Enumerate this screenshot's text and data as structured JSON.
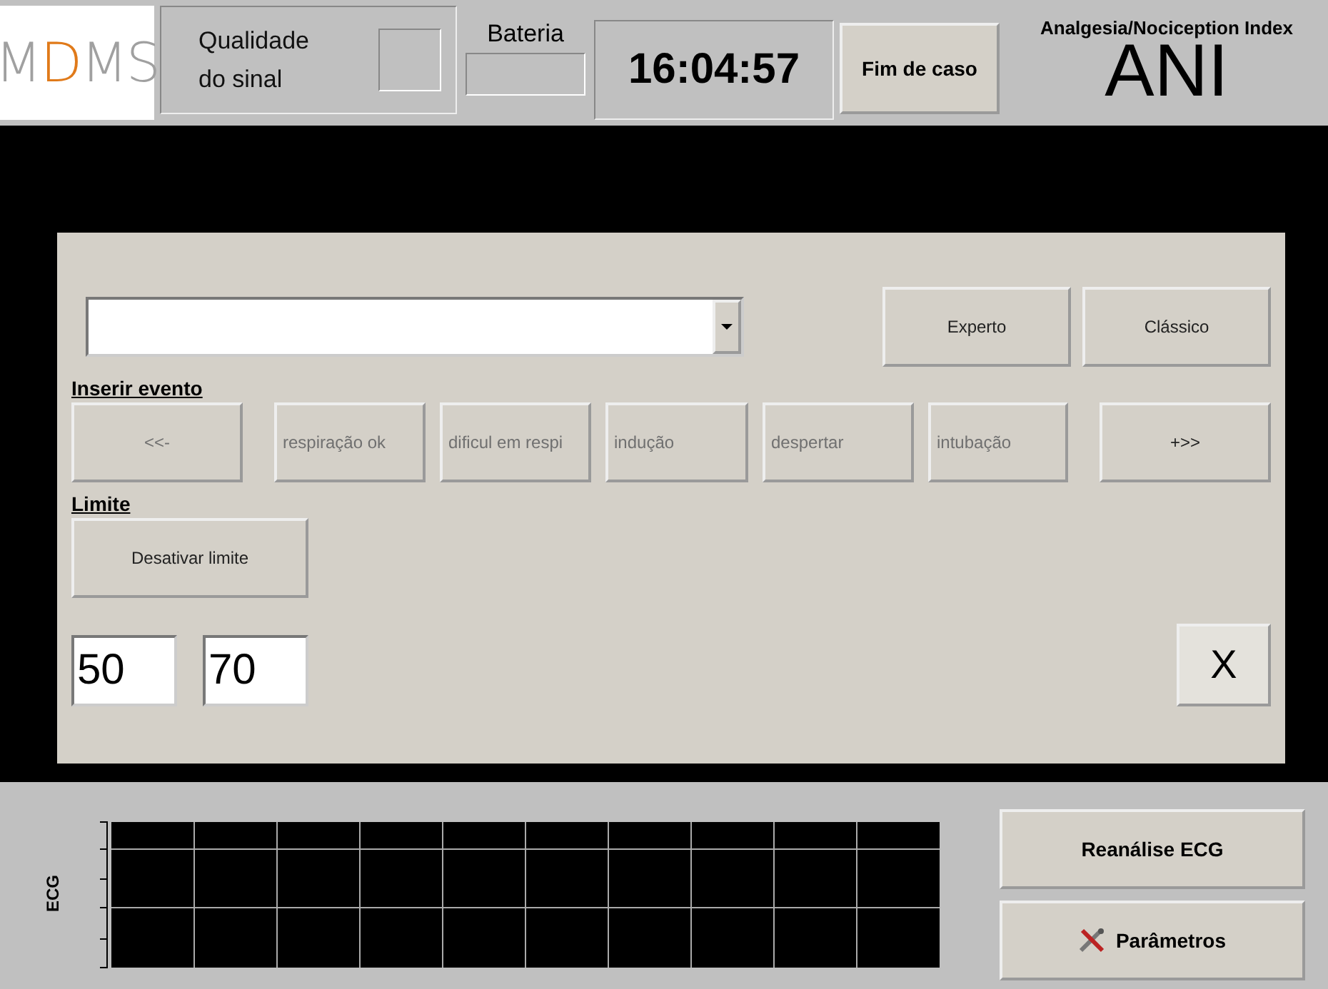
{
  "logo": [
    {
      "text": "M",
      "accent": false
    },
    {
      "text": "D",
      "accent": true
    },
    {
      "text": "M",
      "accent": false
    },
    {
      "text": "S",
      "accent": false
    }
  ],
  "signal_quality": {
    "label_lines": [
      "Qualidade",
      "do sinal"
    ]
  },
  "battery": {
    "label": "Bateria"
  },
  "clock": "16:04:57",
  "end_case_button": "Fim de caso",
  "index": {
    "subtitle": "Analgesia/Nociception Index",
    "name": "ANI"
  },
  "mode_buttons": [
    "Experto",
    "Clássico"
  ],
  "insert_event": {
    "heading": "Inserir evento",
    "buttons": [
      {
        "label": "<<-",
        "disabled": true
      },
      {
        "label": "respiração ok",
        "disabled": true
      },
      {
        "label": "dificul em respi",
        "disabled": true
      },
      {
        "label": "indução",
        "disabled": true
      },
      {
        "label": "despertar",
        "disabled": true
      },
      {
        "label": "intubação",
        "disabled": true
      },
      {
        "label": "+>>",
        "disabled": false
      }
    ]
  },
  "limit": {
    "heading": "Limite",
    "button": "Desativar limite",
    "low": "50",
    "high": "70"
  },
  "close_button": "X",
  "ecg": {
    "label": "ECG"
  },
  "side_buttons": [
    {
      "label": "Reanálise ECG",
      "kind": "plain"
    },
    {
      "label": "Parâmetros",
      "kind": "settings"
    }
  ]
}
